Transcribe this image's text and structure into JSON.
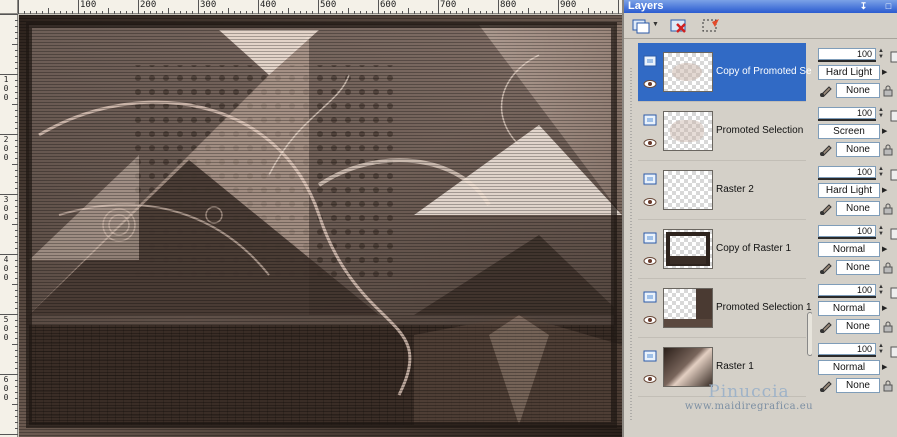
{
  "palette": {
    "title": "Layers",
    "pin_icon": "pin-icon",
    "close_icon": "close-icon",
    "toolbar": [
      {
        "name": "new-raster-layer-button",
        "icon": "new-layer-icon"
      },
      {
        "name": "delete-layer-button",
        "icon": "delete-layer-icon"
      },
      {
        "name": "selection-layer-button",
        "icon": "selection-icon"
      }
    ]
  },
  "rulers": {
    "top_labels": [
      "100",
      "200",
      "300",
      "400",
      "500",
      "600",
      "700",
      "800",
      "900"
    ],
    "left_labels": [
      "1",
      "0",
      "0",
      "2",
      "0",
      "0",
      "3",
      "0",
      "0",
      "4",
      "0",
      "0",
      "5",
      "0",
      "0",
      "6",
      "0",
      "0"
    ]
  },
  "layers": [
    {
      "name": "Copy of Promoted Se",
      "selected": true,
      "thumb": "transparent-soft",
      "opacity": "100",
      "blend": "Hard Light",
      "mask": "None"
    },
    {
      "name": "Promoted Selection",
      "selected": false,
      "thumb": "transparent-soft",
      "opacity": "100",
      "blend": "Screen",
      "mask": "None"
    },
    {
      "name": "Raster 2",
      "selected": false,
      "thumb": "transparent",
      "opacity": "100",
      "blend": "Hard Light",
      "mask": "None"
    },
    {
      "name": "Copy of Raster 1",
      "selected": false,
      "thumb": "frame",
      "opacity": "100",
      "blend": "Normal",
      "mask": "None"
    },
    {
      "name": "Promoted Selection 1",
      "selected": false,
      "thumb": "partial",
      "opacity": "100",
      "blend": "Normal",
      "mask": "None"
    },
    {
      "name": "Raster 1",
      "selected": false,
      "thumb": "image",
      "opacity": "100",
      "blend": "Normal",
      "mask": "None"
    }
  ],
  "watermark": {
    "name": "Pinuccia",
    "url": "www.maidiregrafica.eu"
  },
  "colors": {
    "selection": "#316ac5",
    "titlebar": "#2a5bd0",
    "art_dark": "#3a2e27",
    "art_light": "#e8d5c8"
  }
}
